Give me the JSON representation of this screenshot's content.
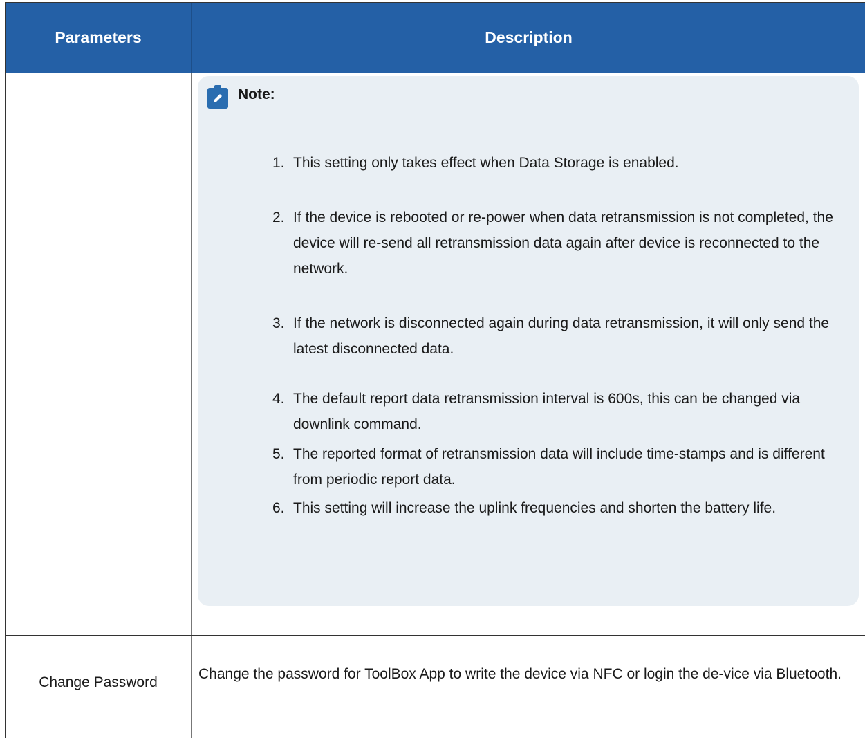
{
  "table": {
    "header": {
      "parameters": "Parameters",
      "description": "Description"
    },
    "note": {
      "title": "Note:",
      "icon": "pencil-note-icon",
      "items": [
        {
          "num": "1.",
          "text": "This setting only takes effect when Data Storage is enabled."
        },
        {
          "num": "2.",
          "text": "If the device is rebooted or re-power when data retransmission is not completed, the device will re-send all retransmission data again after device is reconnected to the network."
        },
        {
          "num": "3.",
          "text": "If the network is disconnected again during data retransmission, it will only send the latest disconnected data."
        },
        {
          "num": "4.",
          "text": "The default report data retransmission interval is 600s, this can be changed via downlink command."
        },
        {
          "num": "5.",
          "text": "The reported format of retransmission data will include time-stamps and is different from periodic report data."
        },
        {
          "num": "6.",
          "text": "This setting will increase the uplink frequencies and shorten the battery life."
        }
      ]
    },
    "rows": [
      {
        "parameter": "Change Password",
        "description": "Change the password for ToolBox App to write the device via NFC or login the de-vice via Bluetooth."
      }
    ]
  },
  "colors": {
    "header_bg": "#2460a6",
    "note_bg": "#e9eff4",
    "icon_bg": "#2a6db0"
  }
}
